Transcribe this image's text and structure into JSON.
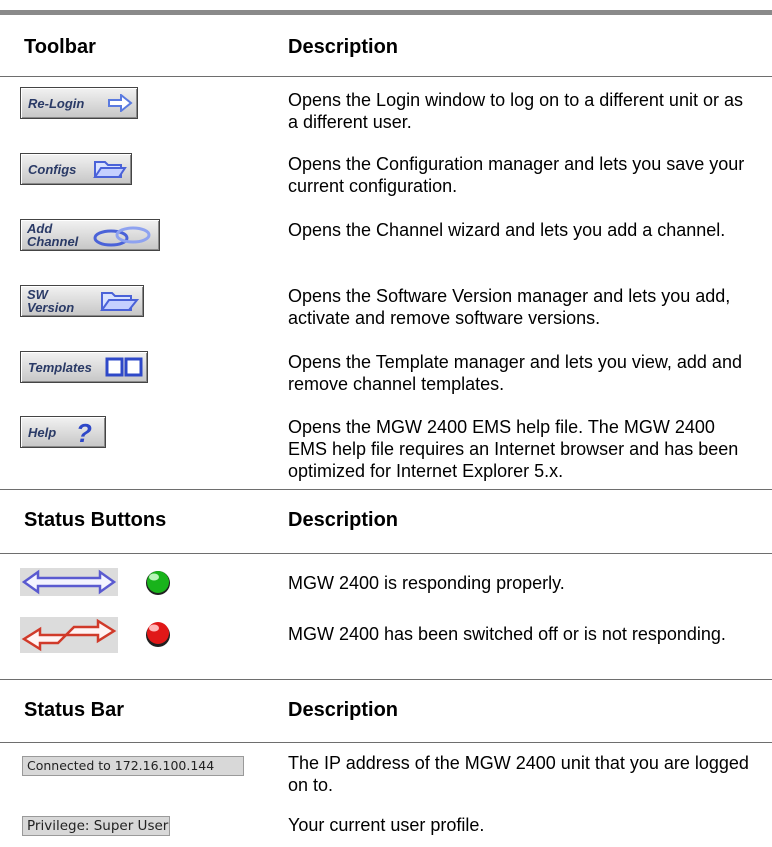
{
  "sections": {
    "toolbar": {
      "header_left": "Toolbar",
      "header_right": "Description",
      "rows": [
        {
          "button": "Re-Login",
          "icon": "arrow-right-icon",
          "desc": "Opens the Login window to log on to a different unit or as a different user."
        },
        {
          "button": "Configs",
          "icon": "folder-icon",
          "desc": "Opens the Configuration manager and lets you save your current configuration."
        },
        {
          "button_line1": "Add",
          "button_line2": "Channel",
          "icon": "chain-link-icon",
          "desc": "Opens the Channel wizard and lets you add a channel."
        },
        {
          "button_line1": "SW",
          "button_line2": "Version",
          "icon": "open-folder-icon",
          "desc": "Opens the Software Version manager and lets you add, activate and remove software versions."
        },
        {
          "button": "Templates",
          "icon": "double-box-icon",
          "desc": "Opens the Template manager and lets you view, add and remove channel templates."
        },
        {
          "button": "Help",
          "icon": "question-mark-icon",
          "desc": "Opens the MGW 2400 EMS help file. The MGW 2400 EMS help file requires an Internet browser and has been optimized for Internet Explorer 5.x."
        }
      ]
    },
    "status_buttons": {
      "header_left": "Status Buttons",
      "header_right": "Description",
      "rows": [
        {
          "arrow_color": "#5a5ad0",
          "led_color": "#19b31b",
          "desc": "MGW 2400 is responding properly."
        },
        {
          "arrow_color": "#d03a2a",
          "led_color": "#e01818",
          "desc": "MGW 2400 has been switched off or is not responding."
        }
      ]
    },
    "status_bar": {
      "header_left": "Status Bar",
      "header_right": "Description",
      "rows": [
        {
          "field": "Connected to 172.16.100.144",
          "desc": "The IP address of the MGW 2400 unit that you are logged on to."
        },
        {
          "field": "Privilege: Super User",
          "desc": "Your current user profile."
        }
      ]
    }
  }
}
